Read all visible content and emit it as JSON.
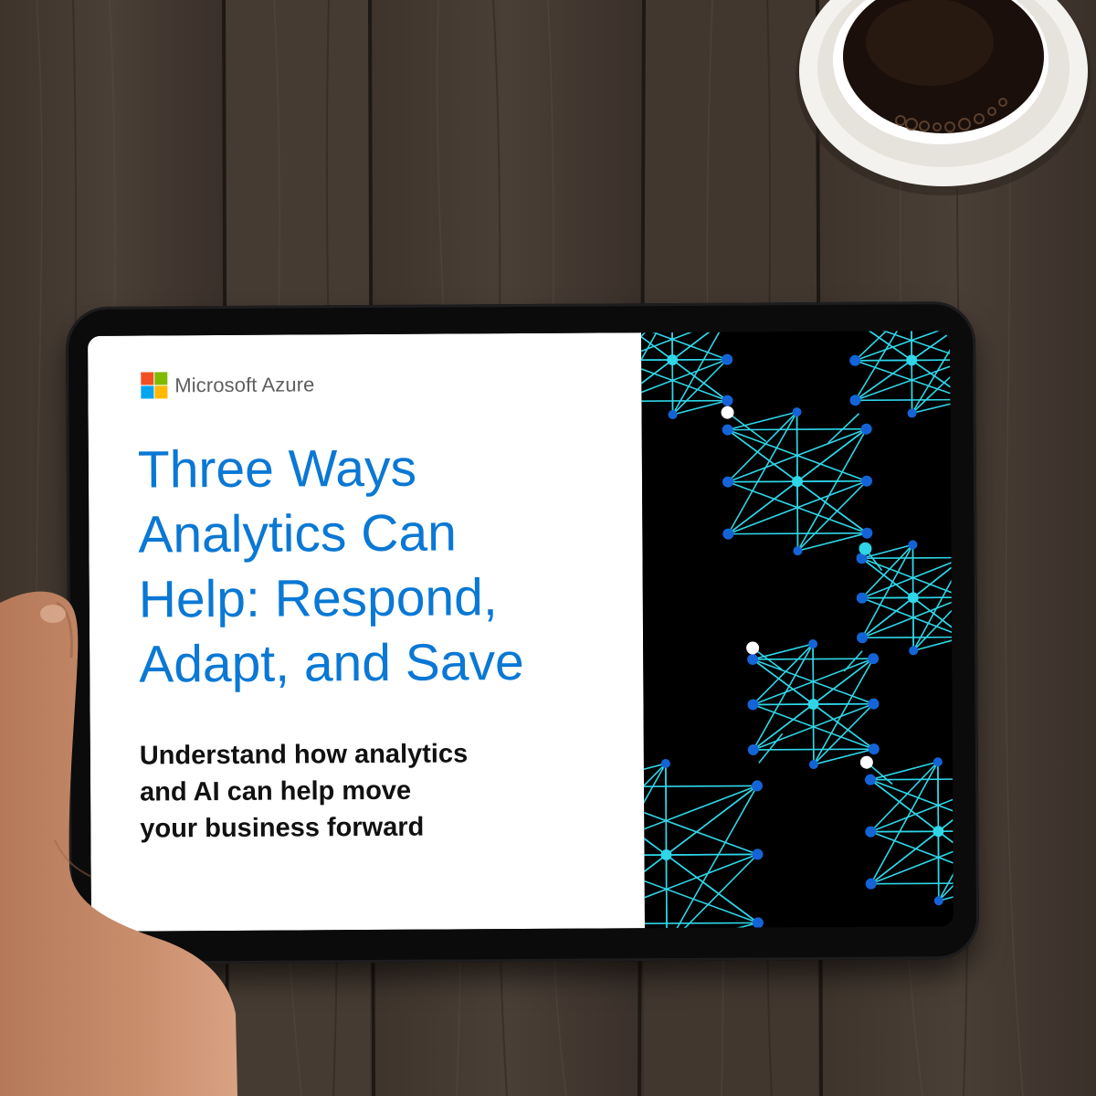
{
  "ebook": {
    "brand": "Microsoft Azure",
    "headline": "Three Ways\nAnalytics Can\nHelp: Respond,\nAdapt, and Save",
    "subheadline": "Understand how analytics\nand AI can help move\nyour business forward"
  },
  "colors": {
    "headline": "#0A78D4",
    "network_line": "#2FD6E8",
    "network_node_dark": "#1464D8",
    "network_node_bright": "#2FD6E8",
    "screen_dark": "#000000",
    "logo": [
      "#F25022",
      "#7FBA00",
      "#00A4EF",
      "#FFB900"
    ]
  },
  "icons": [
    "microsoft-logo-icon",
    "network-graphic",
    "coffee-cup",
    "hand"
  ]
}
